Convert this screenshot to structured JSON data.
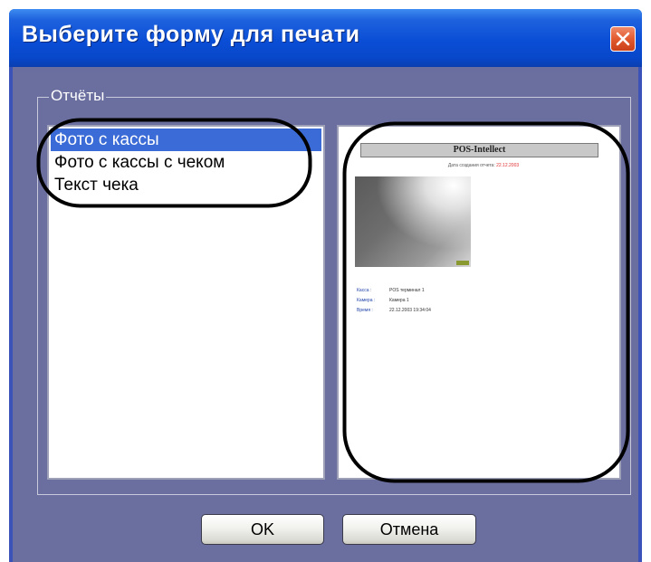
{
  "window": {
    "title": "Выберите форму для печати"
  },
  "group": {
    "label": "Отчёты"
  },
  "reports": {
    "items": [
      {
        "label": "Фото с кассы",
        "selected": true
      },
      {
        "label": "Фото с кассы с чеком",
        "selected": false
      },
      {
        "label": "Текст чека",
        "selected": false
      }
    ]
  },
  "preview": {
    "header": "POS-Intellect",
    "date_label": "Дата создания отчета:",
    "date_value": "22.12.2003",
    "fields": [
      {
        "label": "Касса :",
        "value": "POS терминал 1"
      },
      {
        "label": "Камера :",
        "value": "Камера 1"
      },
      {
        "label": "Время :",
        "value": "22.12.2003 19:34:04"
      }
    ]
  },
  "buttons": {
    "ok": "OK",
    "cancel": "Отмена"
  },
  "colors": {
    "title_bar": "#0a4ed6",
    "client_bg": "#6b6fa0",
    "selection": "#3b6bd6",
    "close_button": "#e25a2f"
  },
  "icons": {
    "close": "close-icon"
  }
}
